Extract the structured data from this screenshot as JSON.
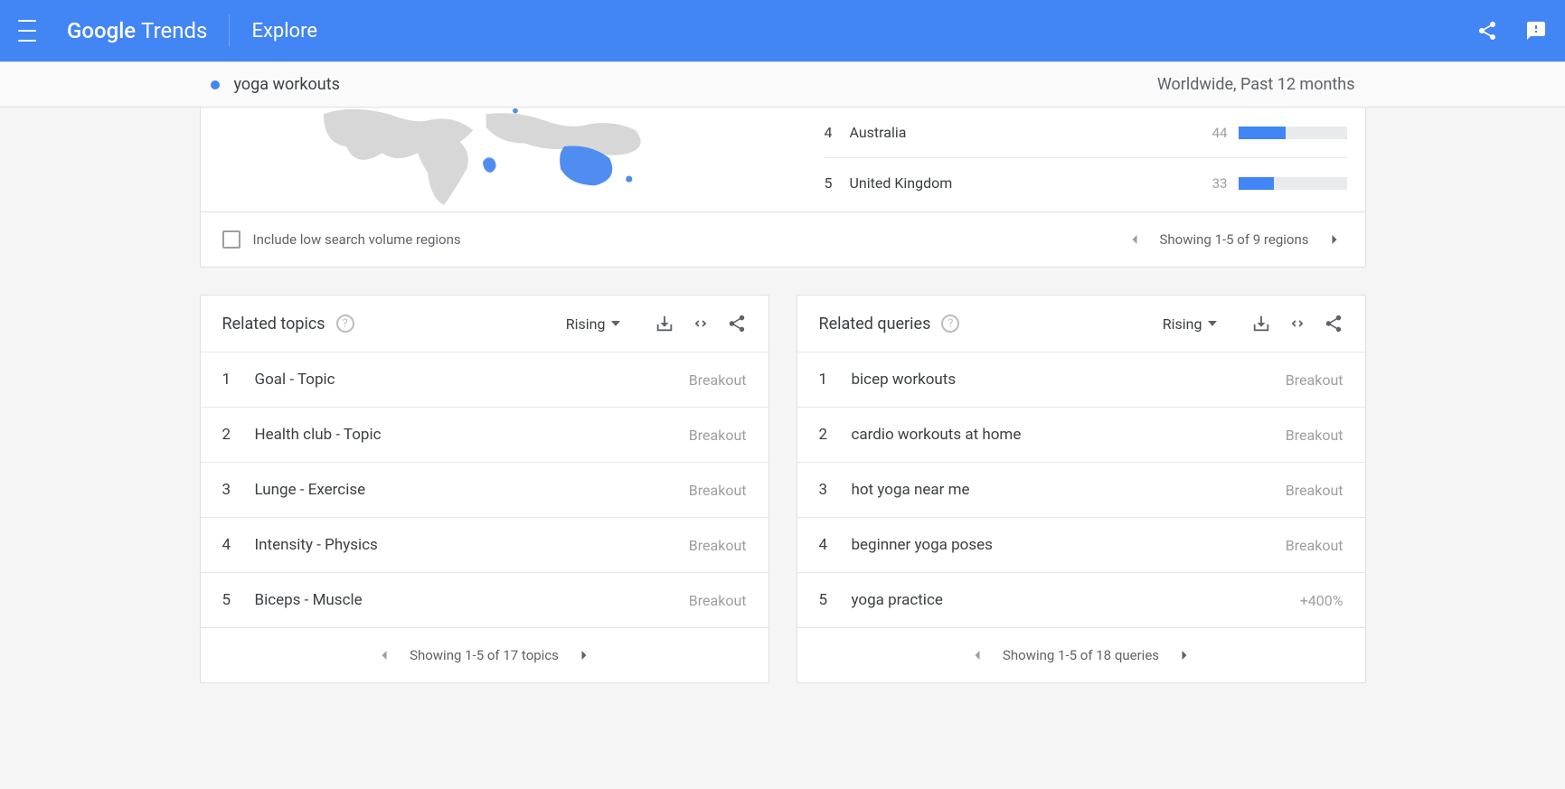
{
  "header": {
    "logo_first": "Google",
    "logo_second": "Trends",
    "page": "Explore"
  },
  "subheader": {
    "term": "yoga workouts",
    "scope": "Worldwide, Past 12 months"
  },
  "regions": {
    "items": [
      {
        "rank": "4",
        "name": "Australia",
        "value": "44",
        "pct": 44
      },
      {
        "rank": "5",
        "name": "United Kingdom",
        "value": "33",
        "pct": 33
      }
    ],
    "checkbox_label": "Include low search volume regions",
    "pager": "Showing 1-5 of 9 regions"
  },
  "topics": {
    "title": "Related topics",
    "sort": "Rising",
    "items": [
      {
        "rank": "1",
        "text": "Goal - Topic",
        "value": "Breakout"
      },
      {
        "rank": "2",
        "text": "Health club - Topic",
        "value": "Breakout"
      },
      {
        "rank": "3",
        "text": "Lunge - Exercise",
        "value": "Breakout"
      },
      {
        "rank": "4",
        "text": "Intensity - Physics",
        "value": "Breakout"
      },
      {
        "rank": "5",
        "text": "Biceps - Muscle",
        "value": "Breakout"
      }
    ],
    "pager": "Showing 1-5 of 17 topics"
  },
  "queries": {
    "title": "Related queries",
    "sort": "Rising",
    "items": [
      {
        "rank": "1",
        "text": "bicep workouts",
        "value": "Breakout"
      },
      {
        "rank": "2",
        "text": "cardio workouts at home",
        "value": "Breakout"
      },
      {
        "rank": "3",
        "text": "hot yoga near me",
        "value": "Breakout"
      },
      {
        "rank": "4",
        "text": "beginner yoga poses",
        "value": "Breakout"
      },
      {
        "rank": "5",
        "text": "yoga practice",
        "value": "+400%"
      }
    ],
    "pager": "Showing 1-5 of 18 queries"
  }
}
